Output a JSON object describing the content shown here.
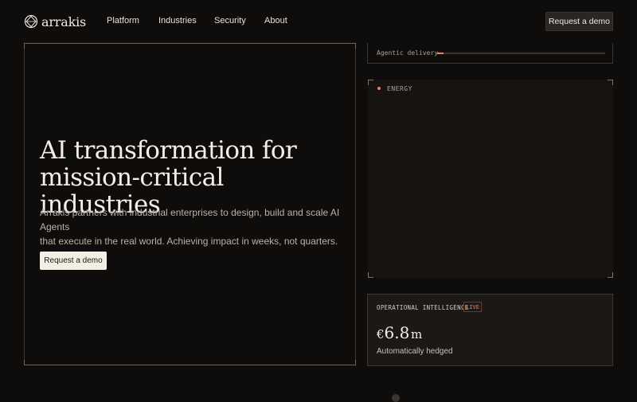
{
  "nav": {
    "logo_text": "arrakis",
    "links": [
      "Platform",
      "Industries",
      "Security",
      "About"
    ],
    "cta_label": "Request a demo"
  },
  "hero": {
    "title_line1": "AI transformation for",
    "title_line2": "mission-critical industries",
    "subtitle_line1": "Arrakis partners with industrial enterprises to design, build and scale AI Agents",
    "subtitle_line2": "that execute in the real world. Achieving impact in weeks, not quarters.",
    "cta_label": "Request a demo"
  },
  "agentic_delivery": {
    "label": "Agentic delivery",
    "progress_fraction": 0.04,
    "accent_color": "#e9855a"
  },
  "energy_panel": {
    "label": "ENERGY",
    "dot_color": "#e9855a"
  },
  "operational_intelligence": {
    "label": "OPERATIONAL INTELLIGENCE",
    "badge": "LIVE",
    "currency": "€",
    "value": "6.8",
    "unit": "m",
    "caption": "Automatically hedged"
  },
  "colors": {
    "background": "#0f0d0c",
    "accent": "#e9855a",
    "hero_cta_bg": "#f4efe4"
  }
}
